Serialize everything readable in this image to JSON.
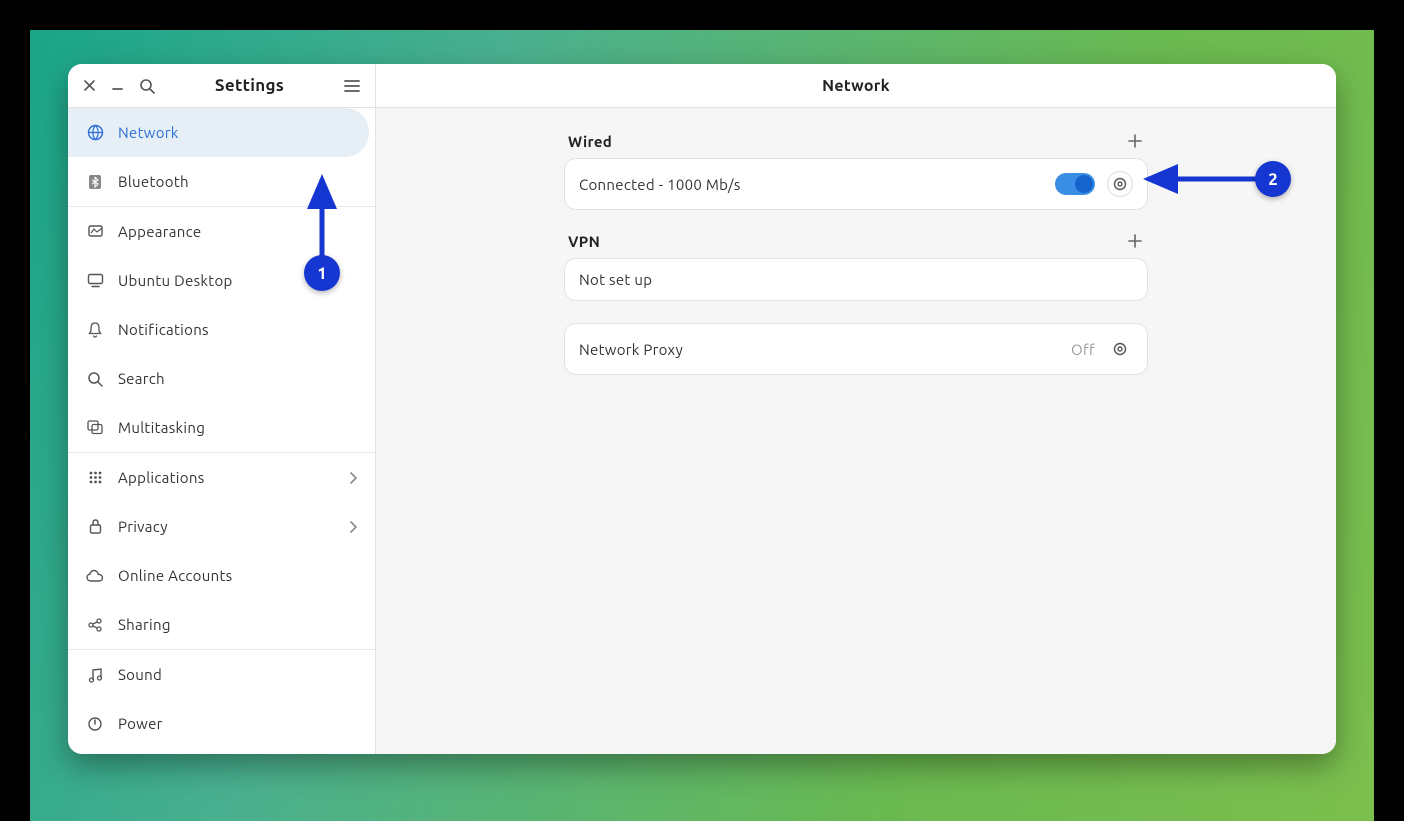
{
  "header": {
    "title": "Settings"
  },
  "main": {
    "title": "Network",
    "wired": {
      "title": "Wired",
      "status": "Connected - 1000 Mb/s"
    },
    "vpn": {
      "title": "VPN",
      "status": "Not set up"
    },
    "proxy": {
      "title": "Network Proxy",
      "status": "Off"
    }
  },
  "sidebar": {
    "items": [
      {
        "label": "Network"
      },
      {
        "label": "Bluetooth"
      },
      {
        "label": "Appearance"
      },
      {
        "label": "Ubuntu Desktop"
      },
      {
        "label": "Notifications"
      },
      {
        "label": "Search"
      },
      {
        "label": "Multitasking"
      },
      {
        "label": "Applications"
      },
      {
        "label": "Privacy"
      },
      {
        "label": "Online Accounts"
      },
      {
        "label": "Sharing"
      },
      {
        "label": "Sound"
      },
      {
        "label": "Power"
      }
    ]
  },
  "annotations": {
    "a1": "1",
    "a2": "2"
  }
}
